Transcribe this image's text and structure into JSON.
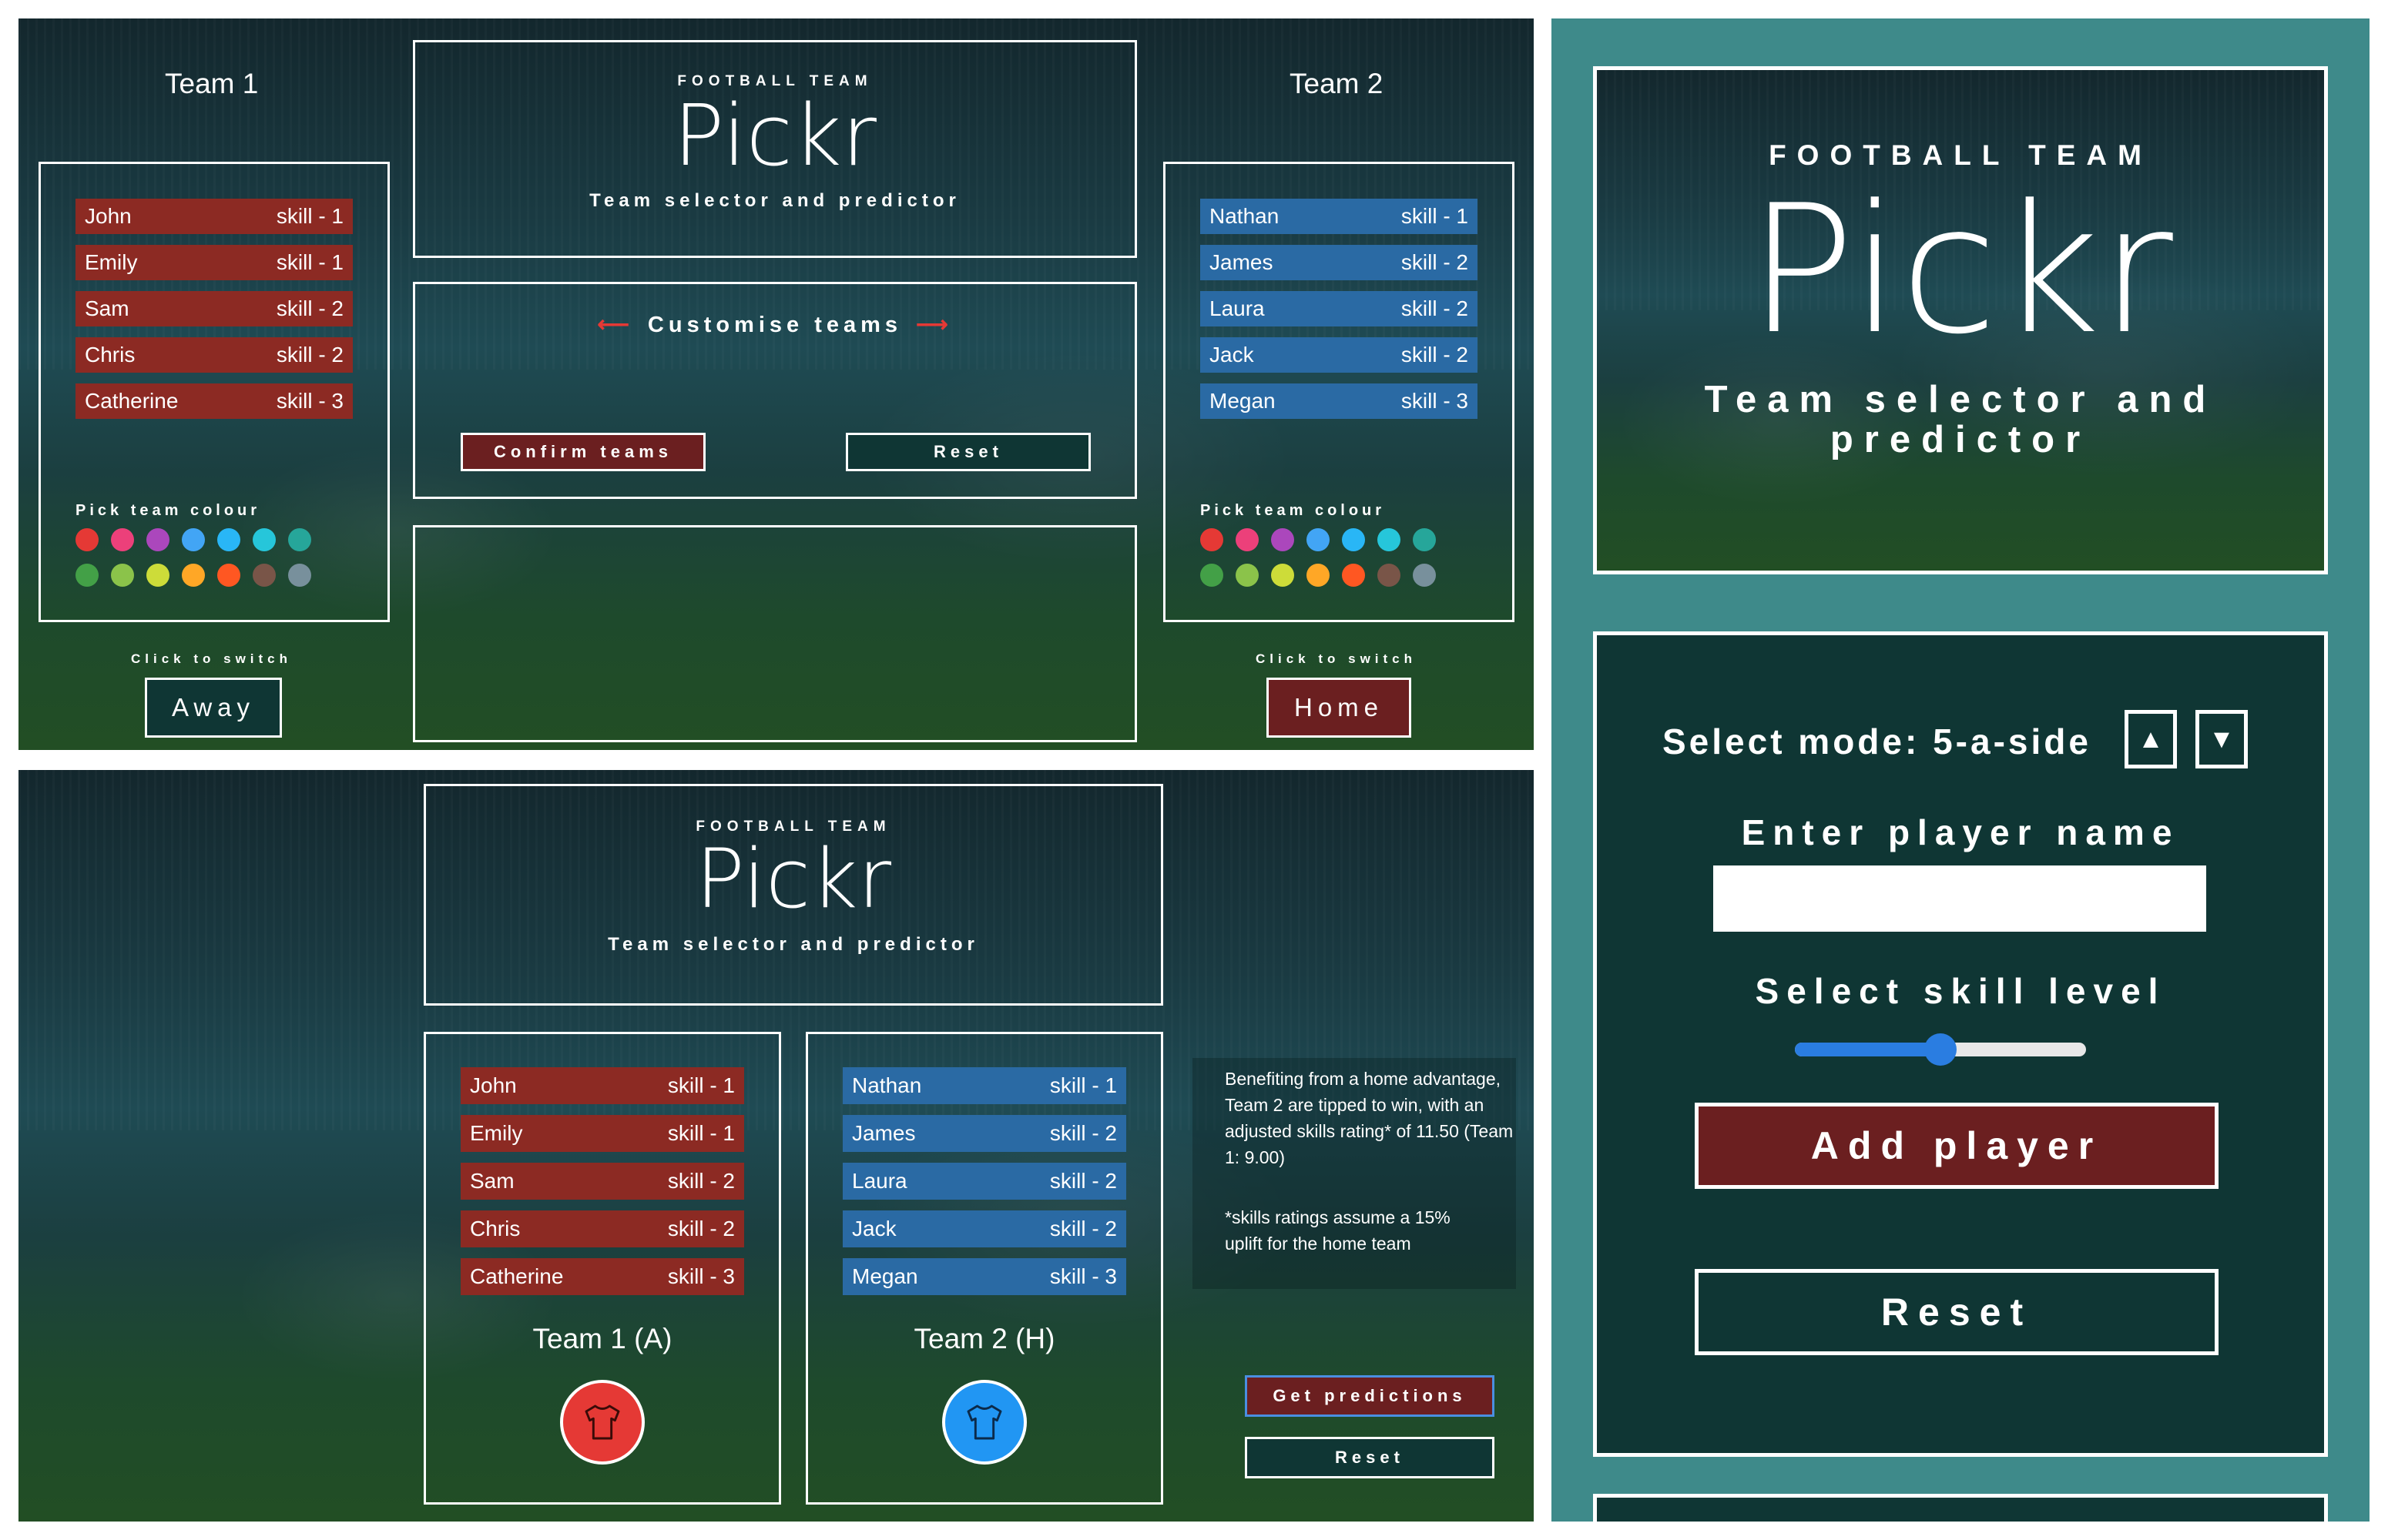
{
  "colors": {
    "red_row": "#8c2a23",
    "blue_row": "#2a6aa4",
    "teal_frame": "#3e8a8a",
    "dark_teal": "#0f3634",
    "btn_dark_red": "#6b1f20"
  },
  "brand": {
    "kicker": "FOOTBALL TEAM",
    "logo": "Pickr",
    "tagline": "Team selector and predictor"
  },
  "panel1": {
    "team1_title": "Team 1",
    "team2_title": "Team 2",
    "customise_label": "Customise teams",
    "confirm_label": "Confirm teams",
    "reset_label": "Reset",
    "pick_colour_label": "Pick team colour",
    "click_switch_label": "Click to switch",
    "team1_switch": "Away",
    "team2_switch": "Home",
    "colour_swatches": [
      "#e53935",
      "#ec407a",
      "#ab47bc",
      "#42a5f5",
      "#29b6f6",
      "#26c6da",
      "#26a69a",
      "#43a047",
      "#8bc34a",
      "#cddc39",
      "#ffa726",
      "#ff5722",
      "#795548",
      "#78909c"
    ]
  },
  "team1_players": [
    {
      "name": "John",
      "skill": "skill - 1"
    },
    {
      "name": "Emily",
      "skill": "skill - 1"
    },
    {
      "name": "Sam",
      "skill": "skill - 2"
    },
    {
      "name": "Chris",
      "skill": "skill - 2"
    },
    {
      "name": "Catherine",
      "skill": "skill - 3"
    }
  ],
  "team2_players": [
    {
      "name": "Nathan",
      "skill": "skill - 1"
    },
    {
      "name": "James",
      "skill": "skill - 2"
    },
    {
      "name": "Laura",
      "skill": "skill - 2"
    },
    {
      "name": "Jack",
      "skill": "skill - 2"
    },
    {
      "name": "Megan",
      "skill": "skill - 3"
    }
  ],
  "panel2": {
    "team1_label": "Team 1 (A)",
    "team2_label": "Team 2 (H)",
    "prediction_text": "Benefiting from a home advantage, Team 2 are tipped to win, with an adjusted skills rating* of 11.50 (Team 1: 9.00)",
    "footnote_text": "*skills ratings assume a 15% uplift for the home team",
    "get_predictions_label": "Get predictions",
    "reset_label": "Reset"
  },
  "mobile": {
    "select_mode_label": "Select mode: 5-a-side",
    "up_icon": "▲",
    "down_icon": "▼",
    "enter_name_label": "Enter player name",
    "name_value": "",
    "skill_label": "Select skill level",
    "skill_fraction": 0.5,
    "add_player_label": "Add player",
    "reset_label": "Reset"
  }
}
